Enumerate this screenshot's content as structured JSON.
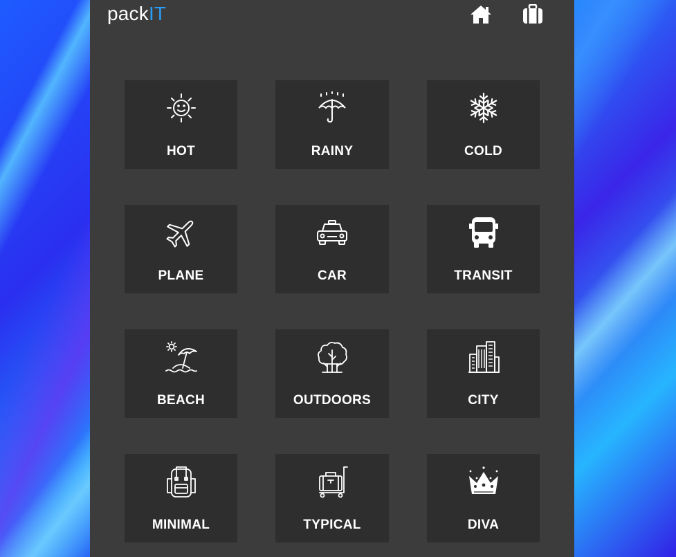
{
  "header": {
    "logo_main": "pack",
    "logo_accent": "IT",
    "home_icon": "home-icon",
    "bag_icon": "suitcase-icon"
  },
  "tiles": [
    {
      "label": "HOT",
      "icon": "sun-icon"
    },
    {
      "label": "RAINY",
      "icon": "umbrella-rain-icon"
    },
    {
      "label": "COLD",
      "icon": "snowflake-icon"
    },
    {
      "label": "PLANE",
      "icon": "plane-icon"
    },
    {
      "label": "CAR",
      "icon": "taxi-icon"
    },
    {
      "label": "TRANSIT",
      "icon": "bus-icon"
    },
    {
      "label": "BEACH",
      "icon": "beach-umbrella-icon"
    },
    {
      "label": "OUTDOORS",
      "icon": "trees-icon"
    },
    {
      "label": "CITY",
      "icon": "city-buildings-icon"
    },
    {
      "label": "MINIMAL",
      "icon": "backpack-icon"
    },
    {
      "label": "TYPICAL",
      "icon": "luggage-cart-icon"
    },
    {
      "label": "DIVA",
      "icon": "crown-icon"
    }
  ],
  "colors": {
    "panel": "#3c3c3c",
    "tile": "#2e2e2e",
    "accent": "#2a9df4",
    "text": "#ffffff"
  }
}
